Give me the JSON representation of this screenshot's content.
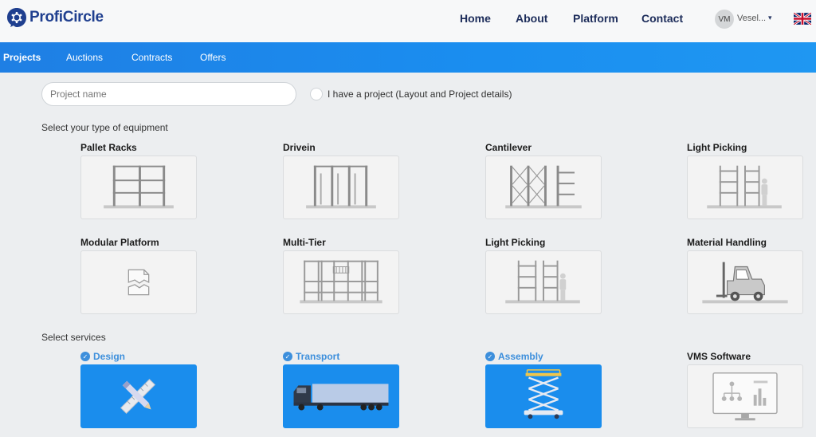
{
  "brand": {
    "name": "ProfiCircle",
    "accent": "#1f3f8f"
  },
  "nav": {
    "home": "Home",
    "about": "About",
    "platform": "Platform",
    "contact": "Contact"
  },
  "user": {
    "initials": "VM",
    "name": "Vesel..."
  },
  "icons": {
    "caret": "▾",
    "check": "✓",
    "flag": "uk-flag-icon"
  },
  "tabs": [
    "Projects",
    "Auctions",
    "Contracts",
    "Offers"
  ],
  "form": {
    "project_placeholder": "Project name",
    "radio_label": "I have a project (Layout and Project details)"
  },
  "sections": {
    "equipment": "Select your type of equipment",
    "services": "Select services"
  },
  "equipment": [
    {
      "title": "Pallet Racks"
    },
    {
      "title": "Drivein"
    },
    {
      "title": "Cantilever"
    },
    {
      "title": "Light Picking"
    },
    {
      "title": "Modular Platform"
    },
    {
      "title": "Multi-Tier"
    },
    {
      "title": "Light Picking"
    },
    {
      "title": "Material Handling"
    }
  ],
  "services": [
    {
      "title": "Design",
      "selected": true
    },
    {
      "title": "Transport",
      "selected": true
    },
    {
      "title": "Assembly",
      "selected": true
    },
    {
      "title": "VMS Software",
      "selected": false
    }
  ],
  "colors": {
    "tab_bar": "#1a8ef0",
    "service_selected": "#1a8ded",
    "service_title": "#3d8fdc"
  }
}
